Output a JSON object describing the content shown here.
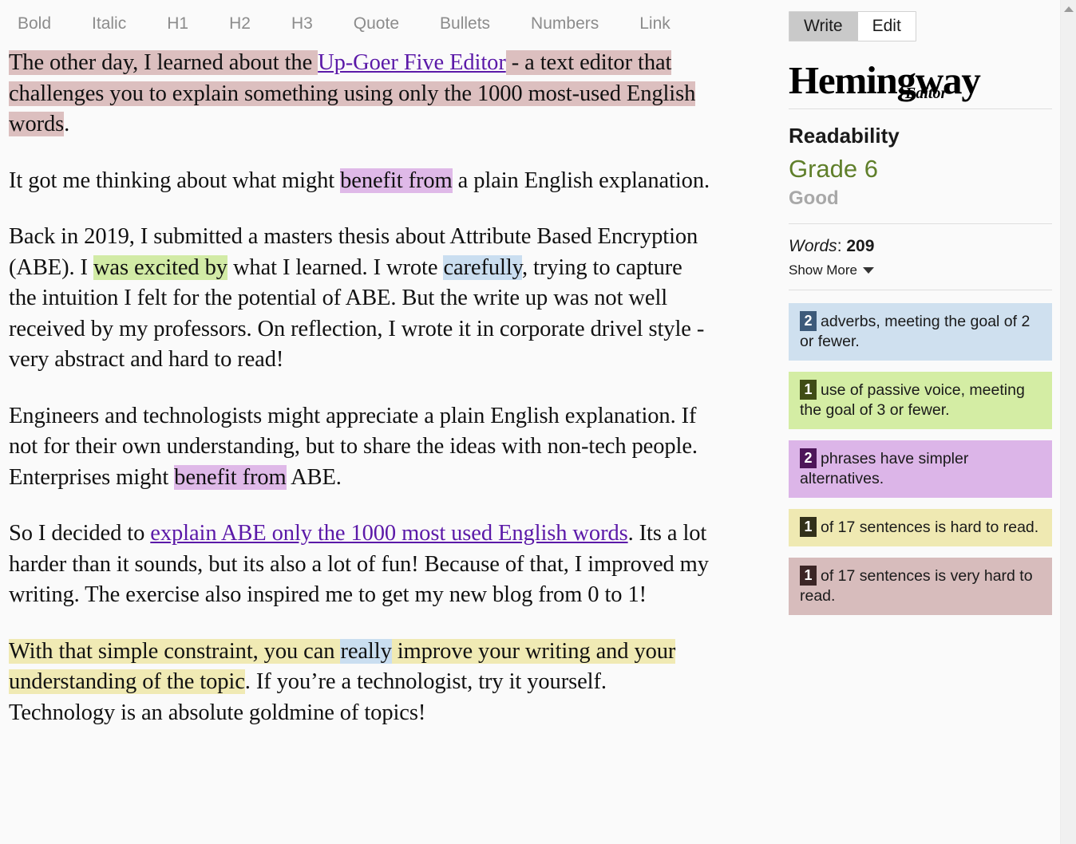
{
  "toolbar": {
    "items": [
      {
        "label": "Bold",
        "name": "toolbar-bold"
      },
      {
        "label": "Italic",
        "name": "toolbar-italic"
      },
      {
        "label": "H1",
        "name": "toolbar-h1"
      },
      {
        "label": "H2",
        "name": "toolbar-h2"
      },
      {
        "label": "H3",
        "name": "toolbar-h3"
      },
      {
        "label": "Quote",
        "name": "toolbar-quote"
      },
      {
        "label": "Bullets",
        "name": "toolbar-bullets"
      },
      {
        "label": "Numbers",
        "name": "toolbar-numbers"
      },
      {
        "label": "Link",
        "name": "toolbar-link"
      }
    ]
  },
  "document": {
    "paragraphs": [
      {
        "id": "p1",
        "segments": [
          {
            "text": "The other day, I learned about the ",
            "style": "veryhard"
          },
          {
            "text": "Up-Goer Five Editor",
            "style": "link"
          },
          {
            "text": " - a text editor that challenges you to explain something using only the 1000 most-used English words",
            "style": "veryhard"
          },
          {
            "text": ".",
            "style": "plain"
          }
        ]
      },
      {
        "id": "p2",
        "segments": [
          {
            "text": "It got me thinking about what might ",
            "style": "plain"
          },
          {
            "text": "benefit from",
            "style": "complex"
          },
          {
            "text": " a plain English explanation.",
            "style": "plain"
          }
        ]
      },
      {
        "id": "p3",
        "segments": [
          {
            "text": "Back in 2019, I submitted a masters thesis about Attribute Based Encryption (ABE). I ",
            "style": "plain"
          },
          {
            "text": "was excited by",
            "style": "passive"
          },
          {
            "text": " what I learned. I wrote ",
            "style": "plain"
          },
          {
            "text": "carefully",
            "style": "adverb"
          },
          {
            "text": ", trying to capture the intuition I felt for the potential of ABE. But the write up was not well received by my professors. On reflection, I wrote it in corporate drivel style - very abstract and hard to read!",
            "style": "plain"
          }
        ]
      },
      {
        "id": "p4",
        "segments": [
          {
            "text": "Engineers and technologists might appreciate a plain English explanation. If not for their own understanding, but to share the ideas with non-tech people. Enterprises might ",
            "style": "plain"
          },
          {
            "text": "benefit from",
            "style": "complex"
          },
          {
            "text": " ABE.",
            "style": "plain"
          }
        ]
      },
      {
        "id": "p5",
        "segments": [
          {
            "text": "So I decided to ",
            "style": "plain"
          },
          {
            "text": "explain ABE only the 1000 most used English words",
            "style": "link"
          },
          {
            "text": ". Its a lot harder than it sounds, but its also a lot of fun! Because of that, I improved my writing. The exercise also inspired me to get my new blog from 0 to 1!",
            "style": "plain"
          }
        ]
      },
      {
        "id": "p6",
        "segments": [
          {
            "text": "With that simple constraint, you can ",
            "style": "hard"
          },
          {
            "text": "really",
            "style": "hard-adverb"
          },
          {
            "text": " improve your writing and your understanding of the topic",
            "style": "hard"
          },
          {
            "text": ". If you’re a technologist, try it yourself. Technology is an absolute goldmine of topics!",
            "style": "plain"
          }
        ]
      }
    ]
  },
  "sidebar": {
    "mode_toggle": {
      "write_label": "Write",
      "edit_label": "Edit",
      "active": "Write"
    },
    "logo": {
      "main": "Hemingway",
      "sub": "Editor"
    },
    "readability": {
      "title": "Readability",
      "grade": "Grade 6",
      "grade_label": "Good",
      "grade_color": "#5f7f2a",
      "words_label": "Words",
      "words_separator": ": ",
      "words_value": "209",
      "show_more_label": "Show More"
    },
    "cards": [
      {
        "name": "card-adverbs",
        "count": "2",
        "text": "adverbs, meeting the goal of 2 or fewer.",
        "bg": "#cfe0ef",
        "badge_bg": "#3d5a7a"
      },
      {
        "name": "card-passive-voice",
        "count": "1",
        "text": "use of passive voice, meeting the goal of 3 or fewer.",
        "bg": "#d4eda4",
        "badge_bg": "#3f4c16"
      },
      {
        "name": "card-complex-phrases",
        "count": "2",
        "text": "phrases have simpler alternatives.",
        "bg": "#dcb5e8",
        "badge_bg": "#4d1659"
      },
      {
        "name": "card-hard-sentences",
        "count": "1",
        "text": "of 17 sentences is hard to read.",
        "bg": "#efe9b2",
        "badge_bg": "#32301a"
      },
      {
        "name": "card-very-hard-sentences",
        "count": "1",
        "text": "of 17 sentences is very hard to read.",
        "bg": "#d7bcbc",
        "badge_bg": "#3b2525"
      }
    ]
  },
  "colors": {
    "highlight_very_hard": "#dcbfbf",
    "highlight_hard": "#f0eab4",
    "highlight_adverb": "#cadef0",
    "highlight_passive": "#d2eba6",
    "highlight_complex": "#dfb9e8",
    "link": "#5b19a8",
    "background": "#fafafa"
  }
}
